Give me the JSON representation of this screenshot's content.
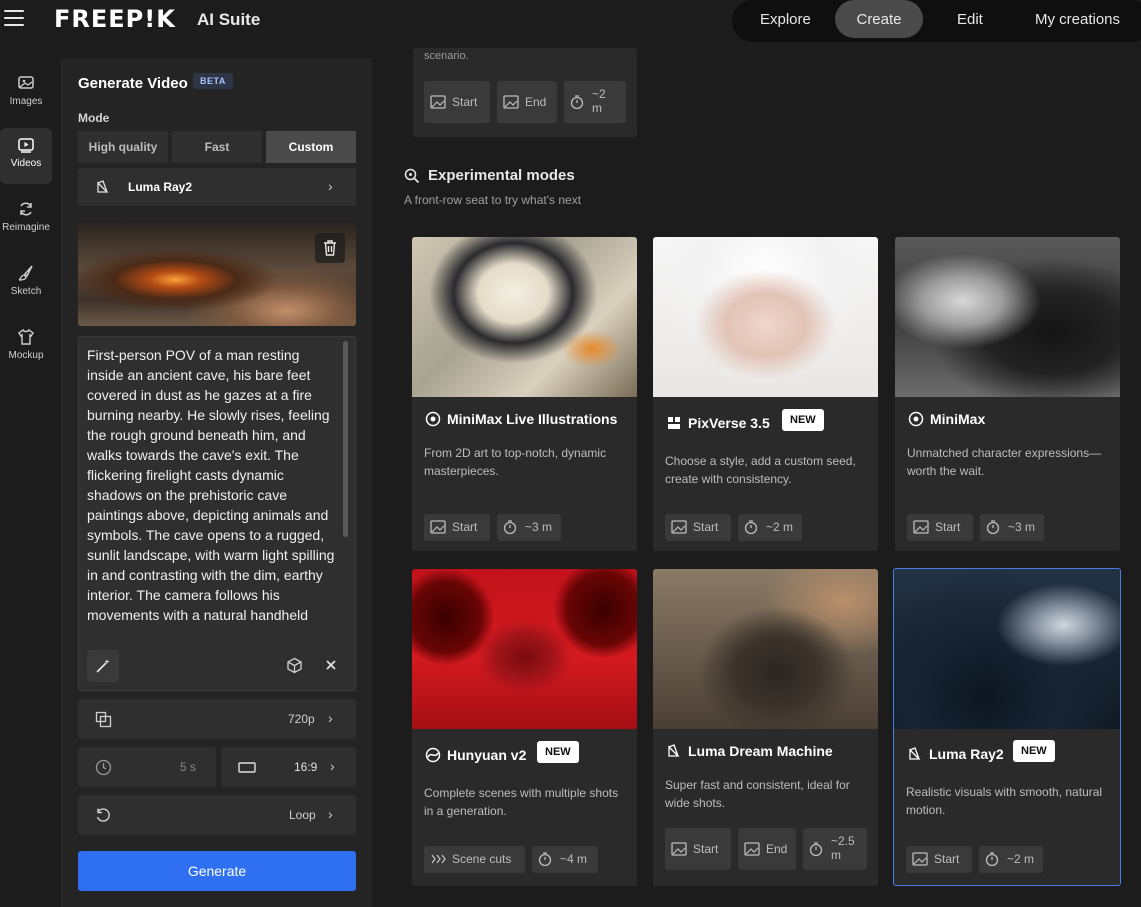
{
  "header": {
    "logo": "FREEP!K",
    "suite": "AI Suite",
    "nav": [
      "Explore",
      "Create",
      "Edit",
      "My creations"
    ],
    "active_nav": "Create"
  },
  "rail": {
    "items": [
      {
        "label": "Images",
        "icon": "image-icon"
      },
      {
        "label": "Videos",
        "icon": "video-icon"
      },
      {
        "label": "Reimagine",
        "icon": "refresh-icon"
      },
      {
        "label": "Sketch",
        "icon": "brush-icon"
      },
      {
        "label": "Mockup",
        "icon": "shirt-icon"
      }
    ],
    "active": "Videos"
  },
  "panel": {
    "title": "Generate Video",
    "badge": "BETA",
    "mode_label": "Mode",
    "modes": [
      "High quality",
      "Fast",
      "Custom"
    ],
    "active_mode": "Custom",
    "model": "Luma Ray2",
    "prompt": "First-person POV of a man resting inside an ancient cave, his bare feet covered in dust as he gazes at a fire burning nearby. He slowly rises, feeling the rough ground beneath him, and walks towards the cave's exit. The flickering firelight casts dynamic shadows on the prehistoric cave paintings above, depicting animals and symbols. The cave opens to a rugged, sunlit landscape, with warm light spilling in and contrasting with the dim, earthy interior. The camera follows his movements with a natural handheld",
    "resolution": "720p",
    "duration": "5 s",
    "aspect": "16:9",
    "loop": "Loop",
    "generate": "Generate"
  },
  "top_card": {
    "snippet": "scenario.",
    "chips": [
      {
        "label": "Start"
      },
      {
        "label": "End"
      },
      {
        "label": "~2\nm"
      }
    ]
  },
  "section": {
    "title": "Experimental modes",
    "subtitle": "A front-row seat to try what's next"
  },
  "cards": [
    {
      "title": "MiniMax Live Illustrations",
      "new": "",
      "desc": "From 2D art to top-notch, dynamic masterpieces.",
      "chips": [
        "Start",
        "~3 m"
      ]
    },
    {
      "title": "PixVerse 3.5",
      "new": "NEW",
      "desc": "Choose a style, add a custom seed, create with consistency.",
      "chips": [
        "Start",
        "~2 m"
      ]
    },
    {
      "title": "MiniMax",
      "new": "",
      "desc": "Unmatched character expressions—worth the wait.",
      "chips": [
        "Start",
        "~3 m"
      ]
    },
    {
      "title": "Hunyuan v2",
      "new": "NEW",
      "desc": "Complete scenes with multiple shots in a generation.",
      "chips": [
        "Scene cuts",
        "~4 m"
      ]
    },
    {
      "title": "Luma Dream Machine",
      "new": "",
      "desc": "Super fast and consistent, ideal for wide shots.",
      "chips": [
        "Start",
        "End",
        "~2.5\nm"
      ]
    },
    {
      "title": "Luma Ray2",
      "new": "NEW",
      "desc": "Realistic visuals with smooth, natural motion.",
      "chips": [
        "Start",
        "~2 m"
      ]
    }
  ]
}
